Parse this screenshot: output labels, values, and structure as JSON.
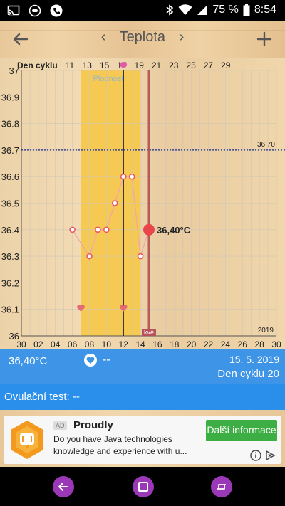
{
  "status_bar": {
    "battery": "75 %",
    "time": "8:54"
  },
  "toolbar": {
    "title": "Teplota",
    "prev": "‹",
    "next": "›"
  },
  "chart_data": {
    "type": "line",
    "title": "",
    "cycle_header_label": "Den cyklu",
    "cycle_day_ticks": [
      "11",
      "13",
      "15",
      "17",
      "19",
      "21",
      "23",
      "25",
      "27",
      "29"
    ],
    "x_ticks": [
      "02",
      "04",
      "06",
      "08",
      "10",
      "12",
      "14",
      "16",
      "18",
      "20",
      "22",
      "24",
      "26",
      "28",
      "30"
    ],
    "x_end_label": "30",
    "y_ticks": [
      "36",
      "36.1",
      "36.2",
      "36.3",
      "36.4",
      "36.5",
      "36.6",
      "36.7",
      "36.8",
      "36.9",
      "37"
    ],
    "ylim": [
      36,
      37
    ],
    "xlim": [
      0,
      30
    ],
    "year_label": "2019",
    "fertile_window_label": "Plodnost",
    "fertile_window": [
      7,
      14
    ],
    "coverline": {
      "value": 36.7,
      "label": "36,70"
    },
    "ovulation_day": 12,
    "period_marker_day": 15,
    "period_label": "kvě",
    "hearts_days": [
      7,
      12
    ],
    "series": [
      {
        "x": [
          6,
          8,
          9,
          10,
          11,
          12,
          13,
          14,
          15
        ],
        "values": [
          36.4,
          36.3,
          36.4,
          36.4,
          36.5,
          36.6,
          36.6,
          36.3,
          36.4
        ]
      }
    ],
    "current_point": {
      "x": 15,
      "value": 36.4,
      "label": "36,40°C"
    }
  },
  "info": {
    "temp": "36,40°C",
    "intercourse": "--",
    "date": "15. 5. 2019",
    "cycle_day": "Den cyklu 20"
  },
  "ovulation": {
    "text": "Ovulační test: --"
  },
  "ad": {
    "badge": "AD",
    "title": "Proudly",
    "line1": "Do you have Java technologies",
    "line2": "knowledge and experience with u...",
    "cta": "Další informace"
  },
  "colors": {
    "accent": "#3e95e8",
    "fertile": "#f6c84a",
    "point": "#e8464b",
    "coverline": "#1a2a8a",
    "ovulation_line": "#1b1b3a",
    "period_line": "#b65a5a"
  }
}
